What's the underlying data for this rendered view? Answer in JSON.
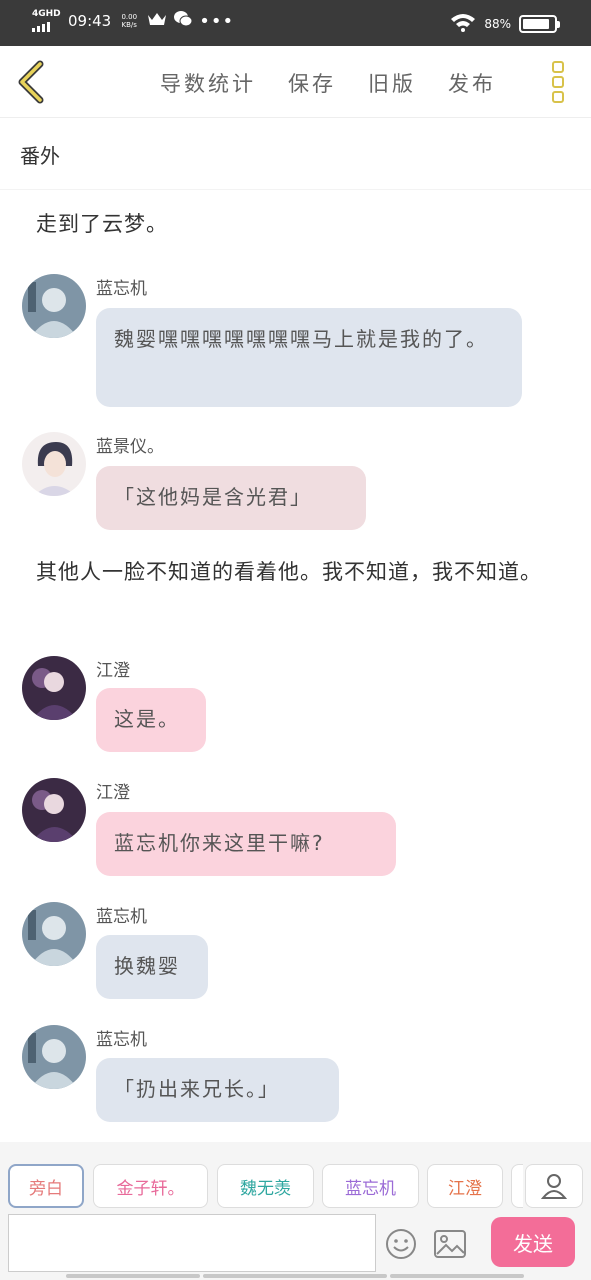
{
  "status_bar": {
    "network": "4GHD",
    "time": "09:43",
    "speed_value": "0.00",
    "speed_unit": "KB/s",
    "battery": "88%",
    "battery_level": 0.88,
    "icons": [
      "crown-icon",
      "wechat-icon",
      "more-dots-icon",
      "wifi-icon",
      "battery-icon"
    ]
  },
  "nav": {
    "back_icon": "chevron-left-icon",
    "items": [
      "导数统计",
      "保存",
      "旧版",
      "发布"
    ],
    "more_icon": "vertical-dots-icon"
  },
  "chapter": {
    "title": "番外"
  },
  "messages": [
    {
      "type": "narration",
      "text": "走到了云梦。"
    },
    {
      "type": "chat",
      "speaker": "蓝忘机",
      "text": "魏婴嘿嘿嘿嘿嘿嘿嘿马上就是我的了。",
      "style": "lan"
    },
    {
      "type": "chat",
      "speaker": "蓝景仪。",
      "text": "「这他妈是含光君」",
      "style": "jing"
    },
    {
      "type": "narration",
      "text": "其他人一脸不知道的看着他。我不知道，我不知道。"
    },
    {
      "type": "chat",
      "speaker": "江澄",
      "text": "这是。",
      "style": "jiang"
    },
    {
      "type": "chat",
      "speaker": "江澄",
      "text": "蓝忘机你来这里干嘛?",
      "style": "jiang"
    },
    {
      "type": "chat",
      "speaker": "蓝忘机",
      "text": "换魏婴",
      "style": "lan"
    },
    {
      "type": "chat",
      "speaker": "蓝忘机",
      "text": "「扔出来兄长。」",
      "style": "lan"
    }
  ],
  "roles": [
    {
      "label": "旁白",
      "color": "#e57a7a"
    },
    {
      "label": "金子轩。",
      "color": "#e86a9a"
    },
    {
      "label": "魏无羡",
      "color": "#2fa7a0"
    },
    {
      "label": "蓝忘机",
      "color": "#9b6bd6"
    },
    {
      "label": "江澄",
      "color": "#e5734a"
    }
  ],
  "composer": {
    "input_value": "",
    "input_placeholder": "",
    "send_label": "发送",
    "emoji_icon": "smiley-icon",
    "image_icon": "image-icon",
    "user_icon": "user-icon"
  },
  "colors": {
    "status_bar_bg": "#3a3a3a",
    "accent_yellow": "#d8c24a",
    "bubble_lan": "#dfe5ee",
    "bubble_jing": "#f0dde0",
    "bubble_jiang": "#fbd3dd",
    "send_button": "#f36d98"
  }
}
